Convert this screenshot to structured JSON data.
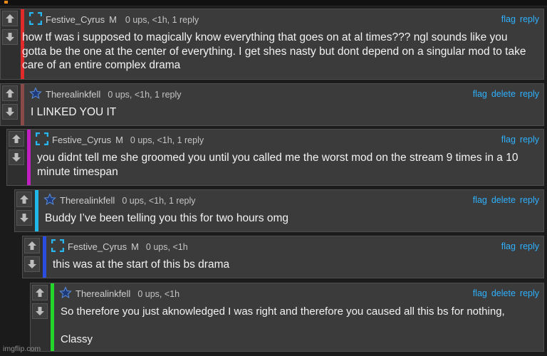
{
  "icons": {
    "upvote": "arrow-up-icon",
    "downvote": "arrow-down-icon",
    "mod_badge": "bracket-square-icon",
    "star_badge": "star-icon"
  },
  "colors": {
    "link": "#2fb1ff",
    "panel": "#3b3b3b",
    "background": "#1b1b1b"
  },
  "watermark": "imgflip.com",
  "comments": [
    {
      "username": "Festive_Cyrus",
      "badge_letter": "M",
      "meta": "0 ups, <1h, 1 reply",
      "actions": [
        "flag",
        "reply"
      ],
      "accent": "#e12a2a",
      "badge": "bracket-square-icon",
      "text": "how tf was i supposed to magically know everything that goes on at al times??? ngl sounds like you gotta be the one at the center of everything. I get shes nasty but dont depend on a singular mod to take care of an entire complex drama"
    },
    {
      "username": "Therealinkfell",
      "meta": "0 ups, <1h, 1 reply",
      "actions": [
        "flag",
        "delete",
        "reply"
      ],
      "accent": "#8a4a4a",
      "badge": "star-icon",
      "text": "I LINKED YOU IT"
    },
    {
      "username": "Festive_Cyrus",
      "badge_letter": "M",
      "meta": "0 ups, <1h, 1 reply",
      "actions": [
        "flag",
        "reply"
      ],
      "accent": "#c21fc2",
      "badge": "bracket-square-icon",
      "text": "you didnt tell me she groomed you until you called me the worst mod on the stream 9 times in a 10 minute timespan"
    },
    {
      "username": "Therealinkfell",
      "meta": "0 ups, <1h, 1 reply",
      "actions": [
        "flag",
        "delete",
        "reply"
      ],
      "accent": "#1fb8e8",
      "badge": "star-icon",
      "text": "Buddy I’ve been telling you this for two hours omg"
    },
    {
      "username": "Festive_Cyrus",
      "badge_letter": "M",
      "meta": "0 ups, <1h",
      "actions": [
        "flag",
        "reply"
      ],
      "accent": "#2a4de0",
      "badge": "bracket-square-icon",
      "text": "this was at the start of this bs drama"
    },
    {
      "username": "Therealinkfell",
      "meta": "0 ups, <1h",
      "actions": [
        "flag",
        "delete",
        "reply"
      ],
      "accent": "#22d62a",
      "badge": "star-icon",
      "text": "So therefore you just aknowledged I was right and therefore you caused all this bs for nothing,",
      "text2": "Classy"
    }
  ]
}
